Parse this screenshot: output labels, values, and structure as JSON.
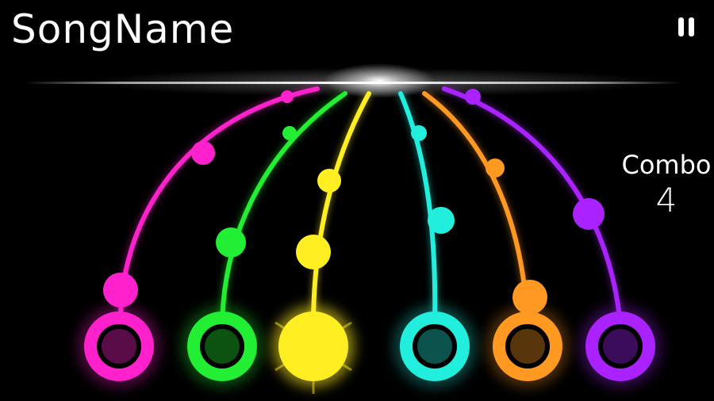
{
  "header": {
    "song_name": "SongName",
    "pause_icon": "pause-icon"
  },
  "combo": {
    "label": "Combo",
    "value": "4"
  },
  "lanes": [
    {
      "name": "pink",
      "color": "#ff22cc",
      "active": false
    },
    {
      "name": "green",
      "color": "#22ee33",
      "active": false
    },
    {
      "name": "yellow",
      "color": "#ffee22",
      "active": true
    },
    {
      "name": "cyan",
      "color": "#22eedd",
      "active": false
    },
    {
      "name": "orange",
      "color": "#ff9922",
      "active": false
    },
    {
      "name": "purple",
      "color": "#aa22ff",
      "active": false
    }
  ]
}
